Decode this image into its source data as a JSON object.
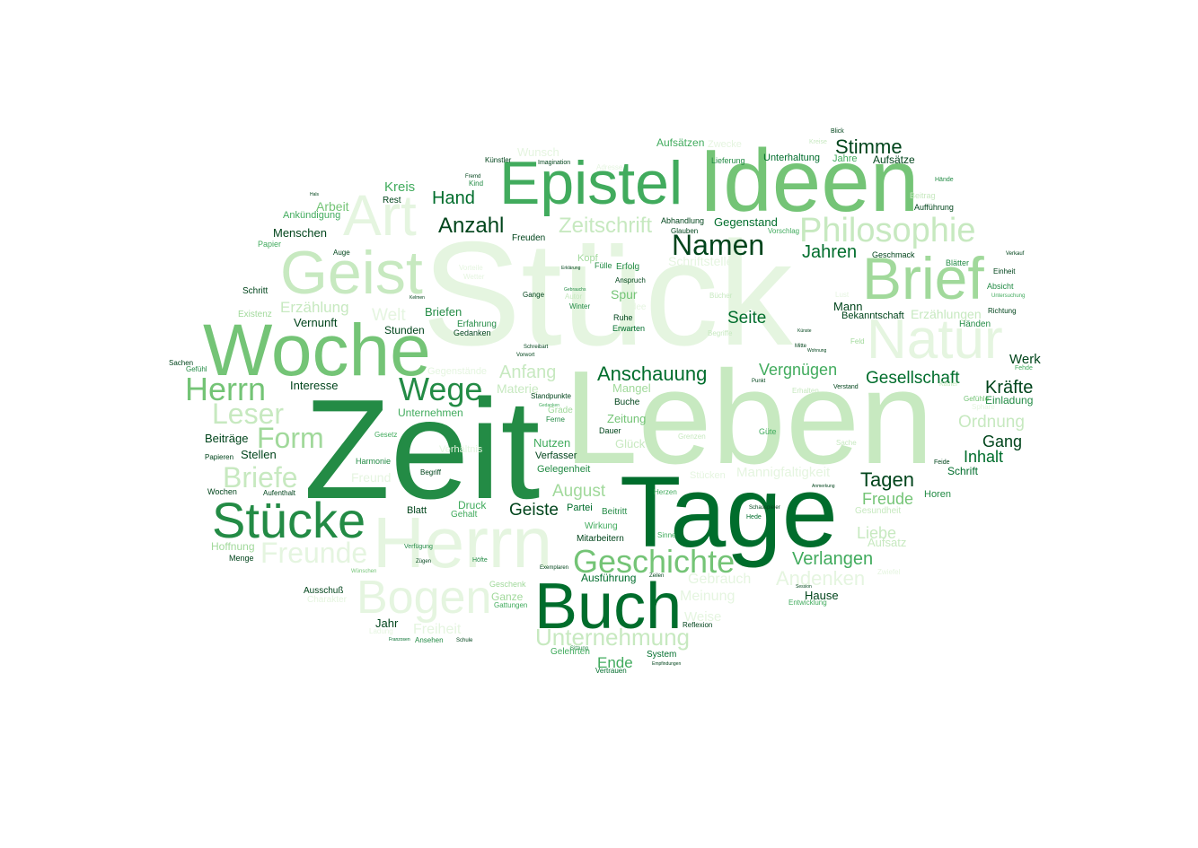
{
  "palette": [
    "#e5f5e0",
    "#c7e9c0",
    "#a1d99b",
    "#74c476",
    "#41ab5d",
    "#238b45",
    "#006d2c",
    "#00441b"
  ],
  "words": [
    {
      "text": "Stück",
      "size": 165,
      "c": 0
    },
    {
      "text": "Leben",
      "size": 148,
      "c": 1
    },
    {
      "text": "Zeit",
      "size": 158,
      "c": 5
    },
    {
      "text": "Tage",
      "size": 112,
      "c": 6
    },
    {
      "text": "Ideen",
      "size": 98,
      "c": 3
    },
    {
      "text": "Woche",
      "size": 82,
      "c": 3
    },
    {
      "text": "Herrn",
      "size": 80,
      "c": 0
    },
    {
      "text": "Brief",
      "size": 66,
      "c": 2
    },
    {
      "text": "Geist",
      "size": 68,
      "c": 1
    },
    {
      "text": "Epistel",
      "size": 68,
      "c": 4
    },
    {
      "text": "Buch",
      "size": 72,
      "c": 6
    },
    {
      "text": "Natur",
      "size": 62,
      "c": 0
    },
    {
      "text": "Art",
      "size": 64,
      "c": 0
    },
    {
      "text": "Stücke",
      "size": 56,
      "c": 5
    },
    {
      "text": "Bogen",
      "size": 52,
      "c": 0
    },
    {
      "text": "Philosophie",
      "size": 38,
      "c": 1
    },
    {
      "text": "Herrn",
      "size": 36,
      "c": 3
    },
    {
      "text": "Wege",
      "size": 36,
      "c": 5
    },
    {
      "text": "Geschichte",
      "size": 36,
      "c": 3
    },
    {
      "text": "Namen",
      "size": 32,
      "c": 7
    },
    {
      "text": "Form",
      "size": 32,
      "c": 2
    },
    {
      "text": "Leser",
      "size": 32,
      "c": 1
    },
    {
      "text": "Briefe",
      "size": 32,
      "c": 1
    },
    {
      "text": "Freunde",
      "size": 32,
      "c": 0
    },
    {
      "text": "Unternehmung",
      "size": 26,
      "c": 1
    },
    {
      "text": "Zeitschrift",
      "size": 24,
      "c": 1
    },
    {
      "text": "Anzahl",
      "size": 24,
      "c": 7
    },
    {
      "text": "Andenken",
      "size": 22,
      "c": 0
    },
    {
      "text": "Anschauung",
      "size": 22,
      "c": 6
    },
    {
      "text": "Hand",
      "size": 20,
      "c": 6
    },
    {
      "text": "Jahren",
      "size": 20,
      "c": 6
    },
    {
      "text": "Stimme",
      "size": 22,
      "c": 7
    },
    {
      "text": "Verlangen",
      "size": 20,
      "c": 4
    },
    {
      "text": "Tagen",
      "size": 22,
      "c": 7
    },
    {
      "text": "Gesellschaft",
      "size": 19,
      "c": 6
    },
    {
      "text": "Kräfte",
      "size": 20,
      "c": 7
    },
    {
      "text": "Ordnung",
      "size": 19,
      "c": 1
    },
    {
      "text": "Anfang",
      "size": 20,
      "c": 1
    },
    {
      "text": "Geiste",
      "size": 19,
      "c": 7
    },
    {
      "text": "August",
      "size": 19,
      "c": 2
    },
    {
      "text": "Seite",
      "size": 19,
      "c": 6
    },
    {
      "text": "Vergnügen",
      "size": 18,
      "c": 4
    },
    {
      "text": "Freude",
      "size": 18,
      "c": 3
    },
    {
      "text": "Liebe",
      "size": 18,
      "c": 1
    },
    {
      "text": "Inhalt",
      "size": 18,
      "c": 6
    },
    {
      "text": "Gang",
      "size": 18,
      "c": 7
    },
    {
      "text": "Erzählung",
      "size": 17,
      "c": 1
    },
    {
      "text": "Welt",
      "size": 19,
      "c": 0
    },
    {
      "text": "Ende",
      "size": 17,
      "c": 4
    },
    {
      "text": "Meinung",
      "size": 16,
      "c": 0
    },
    {
      "text": "Gebrauch",
      "size": 16,
      "c": 0
    },
    {
      "text": "Freiheit",
      "size": 16,
      "c": 0
    },
    {
      "text": "Mannigfaltigkeit",
      "size": 15,
      "c": 0
    },
    {
      "text": "Weise",
      "size": 15,
      "c": 0
    },
    {
      "text": "Erzählungen",
      "size": 14,
      "c": 1
    },
    {
      "text": "Materie",
      "size": 14,
      "c": 1
    },
    {
      "text": "Kreis",
      "size": 15,
      "c": 4
    },
    {
      "text": "Arbeit",
      "size": 14,
      "c": 3
    },
    {
      "text": "Menschen",
      "size": 13,
      "c": 7
    },
    {
      "text": "Briefen",
      "size": 13,
      "c": 5
    },
    {
      "text": "Stunden",
      "size": 12,
      "c": 7
    },
    {
      "text": "Vernunft",
      "size": 13,
      "c": 7
    },
    {
      "text": "Interesse",
      "size": 13,
      "c": 7
    },
    {
      "text": "Stellen",
      "size": 13,
      "c": 7
    },
    {
      "text": "Beiträge",
      "size": 13,
      "c": 7
    },
    {
      "text": "Werk",
      "size": 15,
      "c": 7
    },
    {
      "text": "Hause",
      "size": 13,
      "c": 7
    },
    {
      "text": "Nutzen",
      "size": 13,
      "c": 4
    },
    {
      "text": "Zeitung",
      "size": 13,
      "c": 3
    },
    {
      "text": "Mangel",
      "size": 13,
      "c": 2
    },
    {
      "text": "Spur",
      "size": 14,
      "c": 3
    },
    {
      "text": "Aufsätze",
      "size": 12,
      "c": 7
    },
    {
      "text": "Aufsätzen",
      "size": 12,
      "c": 4
    },
    {
      "text": "Gegenstand",
      "size": 13,
      "c": 6
    },
    {
      "text": "Einladung",
      "size": 12,
      "c": 5
    },
    {
      "text": "Unternehmen",
      "size": 12,
      "c": 4
    },
    {
      "text": "Schrift",
      "size": 12,
      "c": 6
    },
    {
      "text": "Horen",
      "size": 11,
      "c": 5
    },
    {
      "text": "Glück",
      "size": 13,
      "c": 1
    },
    {
      "text": "Gelegenheit",
      "size": 11,
      "c": 5
    },
    {
      "text": "Verfasser",
      "size": 11,
      "c": 7
    },
    {
      "text": "Aufsatz",
      "size": 13,
      "c": 1
    },
    {
      "text": "Hoffnung",
      "size": 12,
      "c": 2
    },
    {
      "text": "Ankündigung",
      "size": 11,
      "c": 4
    },
    {
      "text": "Ausführung",
      "size": 12,
      "c": 6
    },
    {
      "text": "Mann",
      "size": 13,
      "c": 7
    },
    {
      "text": "Bekanntschaft",
      "size": 11,
      "c": 7
    },
    {
      "text": "Unterhaltung",
      "size": 11,
      "c": 6
    },
    {
      "text": "Druck",
      "size": 12,
      "c": 4
    },
    {
      "text": "Blatt",
      "size": 11,
      "c": 7
    },
    {
      "text": "Partei",
      "size": 11,
      "c": 6
    },
    {
      "text": "Ganze",
      "size": 12,
      "c": 2
    },
    {
      "text": "Kopf",
      "size": 11,
      "c": 2
    },
    {
      "text": "Existenz",
      "size": 10,
      "c": 2
    },
    {
      "text": "Schritt",
      "size": 10,
      "c": 7
    },
    {
      "text": "Erfolg",
      "size": 10,
      "c": 5
    },
    {
      "text": "Ruhe",
      "size": 9,
      "c": 7
    },
    {
      "text": "Erwarten",
      "size": 9,
      "c": 6
    },
    {
      "text": "Erfahrung",
      "size": 10,
      "c": 5
    },
    {
      "text": "Gedanken",
      "size": 9,
      "c": 7
    },
    {
      "text": "Wirkung",
      "size": 10,
      "c": 4
    },
    {
      "text": "Mitarbeitern",
      "size": 10,
      "c": 7
    },
    {
      "text": "Beitritt",
      "size": 10,
      "c": 5
    },
    {
      "text": "Gehalt",
      "size": 10,
      "c": 4
    },
    {
      "text": "Grade",
      "size": 10,
      "c": 2
    },
    {
      "text": "Buche",
      "size": 10,
      "c": 7
    },
    {
      "text": "Dauer",
      "size": 9,
      "c": 7
    },
    {
      "text": "Jahr",
      "size": 13,
      "c": 7
    },
    {
      "text": "Charakter",
      "size": 10,
      "c": 0
    },
    {
      "text": "Ausschuß",
      "size": 10,
      "c": 7
    },
    {
      "text": "Gelehrten",
      "size": 10,
      "c": 4
    },
    {
      "text": "System",
      "size": 10,
      "c": 6
    },
    {
      "text": "Vertrauen",
      "size": 8,
      "c": 6
    },
    {
      "text": "Ansehen",
      "size": 8,
      "c": 5
    },
    {
      "text": "Gesundheit",
      "size": 10,
      "c": 1
    },
    {
      "text": "Menge",
      "size": 9,
      "c": 7
    },
    {
      "text": "Harmonie",
      "size": 9,
      "c": 5
    },
    {
      "text": "Aufenthalt",
      "size": 8,
      "c": 7
    },
    {
      "text": "Wochen",
      "size": 9,
      "c": 7
    },
    {
      "text": "Papieren",
      "size": 8,
      "c": 7
    },
    {
      "text": "Begriff",
      "size": 8,
      "c": 7
    },
    {
      "text": "Papier",
      "size": 9,
      "c": 4
    },
    {
      "text": "Auge",
      "size": 8,
      "c": 7
    },
    {
      "text": "Rest",
      "size": 10,
      "c": 7
    },
    {
      "text": "Freuden",
      "size": 10,
      "c": 7
    },
    {
      "text": "Jahre",
      "size": 11,
      "c": 4
    },
    {
      "text": "Lieferung",
      "size": 9,
      "c": 5
    },
    {
      "text": "Geschmack",
      "size": 9,
      "c": 7
    },
    {
      "text": "Blätter",
      "size": 9,
      "c": 5
    },
    {
      "text": "Händen",
      "size": 10,
      "c": 5
    },
    {
      "text": "Absicht",
      "size": 9,
      "c": 5
    },
    {
      "text": "Aufführung",
      "size": 9,
      "c": 7
    },
    {
      "text": "Beitrag",
      "size": 9,
      "c": 1
    },
    {
      "text": "Richtung",
      "size": 8,
      "c": 7
    },
    {
      "text": "Einheit",
      "size": 8,
      "c": 7
    },
    {
      "text": "Feld",
      "size": 8,
      "c": 2
    },
    {
      "text": "Güte",
      "size": 9,
      "c": 4
    },
    {
      "text": "Sache",
      "size": 8,
      "c": 1
    },
    {
      "text": "Zwecke",
      "size": 11,
      "c": 0
    },
    {
      "text": "Wunsch",
      "size": 13,
      "c": 0
    },
    {
      "text": "Künstler",
      "size": 8,
      "c": 7
    },
    {
      "text": "Imagination",
      "size": 7,
      "c": 7
    },
    {
      "text": "Kind",
      "size": 8,
      "c": 5
    },
    {
      "text": "Abhandlung",
      "size": 9,
      "c": 7
    },
    {
      "text": "Glauben",
      "size": 8,
      "c": 7
    },
    {
      "text": "Anspruch",
      "size": 8,
      "c": 7
    },
    {
      "text": "Fülle",
      "size": 9,
      "c": 5
    },
    {
      "text": "Gange",
      "size": 8,
      "c": 7
    },
    {
      "text": "Winter",
      "size": 8,
      "c": 5
    },
    {
      "text": "Autor",
      "size": 8,
      "c": 1
    },
    {
      "text": "Standpunkte",
      "size": 8,
      "c": 7
    },
    {
      "text": "Ferne",
      "size": 8,
      "c": 5
    },
    {
      "text": "Gesetz",
      "size": 8,
      "c": 4
    },
    {
      "text": "Sachen",
      "size": 8,
      "c": 7
    },
    {
      "text": "Gefühl",
      "size": 8,
      "c": 5
    },
    {
      "text": "Verfügung",
      "size": 7,
      "c": 5
    },
    {
      "text": "Zügen",
      "size": 6,
      "c": 7
    },
    {
      "text": "Geschenk",
      "size": 9,
      "c": 2
    },
    {
      "text": "Gattungen",
      "size": 8,
      "c": 4
    },
    {
      "text": "Reflexion",
      "size": 8,
      "c": 7
    },
    {
      "text": "Entwicklung",
      "size": 8,
      "c": 4
    },
    {
      "text": "Herzen",
      "size": 8,
      "c": 4
    },
    {
      "text": "Schriftsteller",
      "size": 14,
      "c": 0
    },
    {
      "text": "Gegenstände",
      "size": 11,
      "c": 0
    },
    {
      "text": "Stücken",
      "size": 11,
      "c": 0
    },
    {
      "text": "Freund",
      "size": 14,
      "c": 0
    },
    {
      "text": "Verhältnis",
      "size": 11,
      "c": 0
    },
    {
      "text": "Bücher",
      "size": 8,
      "c": 1
    },
    {
      "text": "Begriffe",
      "size": 8,
      "c": 1
    },
    {
      "text": "Erhalten",
      "size": 8,
      "c": 1
    },
    {
      "text": "Grenzen",
      "size": 8,
      "c": 1
    },
    {
      "text": "Ladung",
      "size": 8,
      "c": 0
    },
    {
      "text": "Vorschlag",
      "size": 8,
      "c": 4
    },
    {
      "text": "Adresse",
      "size": 8,
      "c": 0
    },
    {
      "text": "Idee",
      "size": 10,
      "c": 0
    },
    {
      "text": "Lust",
      "size": 8,
      "c": 0
    },
    {
      "text": "Kauter",
      "size": 7,
      "c": 1
    },
    {
      "text": "Fehde",
      "size": 7,
      "c": 4
    },
    {
      "text": "Sphäre",
      "size": 8,
      "c": 0
    },
    {
      "text": "Gefühle",
      "size": 8,
      "c": 3
    },
    {
      "text": "Feide",
      "size": 7,
      "c": 7
    },
    {
      "text": "Hände",
      "size": 7,
      "c": 5
    },
    {
      "text": "Kreise",
      "size": 7,
      "c": 1
    },
    {
      "text": "Blick",
      "size": 7,
      "c": 7
    },
    {
      "text": "Untersuchung",
      "size": 6,
      "c": 4
    },
    {
      "text": "Zwiefel",
      "size": 8,
      "c": 0
    },
    {
      "text": "Sinne",
      "size": 8,
      "c": 4
    },
    {
      "text": "Hede",
      "size": 7,
      "c": 6
    },
    {
      "text": "Schauspieler",
      "size": 6,
      "c": 7
    },
    {
      "text": "Höfte",
      "size": 7,
      "c": 5
    },
    {
      "text": "Wünschen",
      "size": 6,
      "c": 3
    },
    {
      "text": "Sitzung",
      "size": 6,
      "c": 5
    },
    {
      "text": "Empfindungen",
      "size": 5,
      "c": 7
    },
    {
      "text": "Schule",
      "size": 6,
      "c": 7
    },
    {
      "text": "Zeilen",
      "size": 6,
      "c": 7
    },
    {
      "text": "Franzosen",
      "size": 5,
      "c": 6
    },
    {
      "text": "Kelmen",
      "size": 5,
      "c": 7
    },
    {
      "text": "Vorwort",
      "size": 6,
      "c": 7
    },
    {
      "text": "Wetter",
      "size": 8,
      "c": 0
    },
    {
      "text": "Vorteile",
      "size": 8,
      "c": 0
    },
    {
      "text": "Kugel",
      "size": 8,
      "c": 0
    },
    {
      "text": "Schreibart",
      "size": 6,
      "c": 7
    },
    {
      "text": "Verkauf",
      "size": 6,
      "c": 7
    },
    {
      "text": "Mitte",
      "size": 6,
      "c": 7
    },
    {
      "text": "Wohnung",
      "size": 5,
      "c": 7
    },
    {
      "text": "Künste",
      "size": 5,
      "c": 7
    },
    {
      "text": "Punkt",
      "size": 6,
      "c": 7
    },
    {
      "text": "Verstand",
      "size": 7,
      "c": 7
    },
    {
      "text": "Anmerkung",
      "size": 5,
      "c": 7
    },
    {
      "text": "Session",
      "size": 5,
      "c": 7
    },
    {
      "text": "Hals",
      "size": 5,
      "c": 7
    },
    {
      "text": "Fremd",
      "size": 6,
      "c": 7
    },
    {
      "text": "Erklärung",
      "size": 5,
      "c": 7
    },
    {
      "text": "Exemplaren",
      "size": 6,
      "c": 7
    },
    {
      "text": "Gebrauchs",
      "size": 5,
      "c": 5
    },
    {
      "text": "Gedanken",
      "size": 5,
      "c": 4
    }
  ]
}
